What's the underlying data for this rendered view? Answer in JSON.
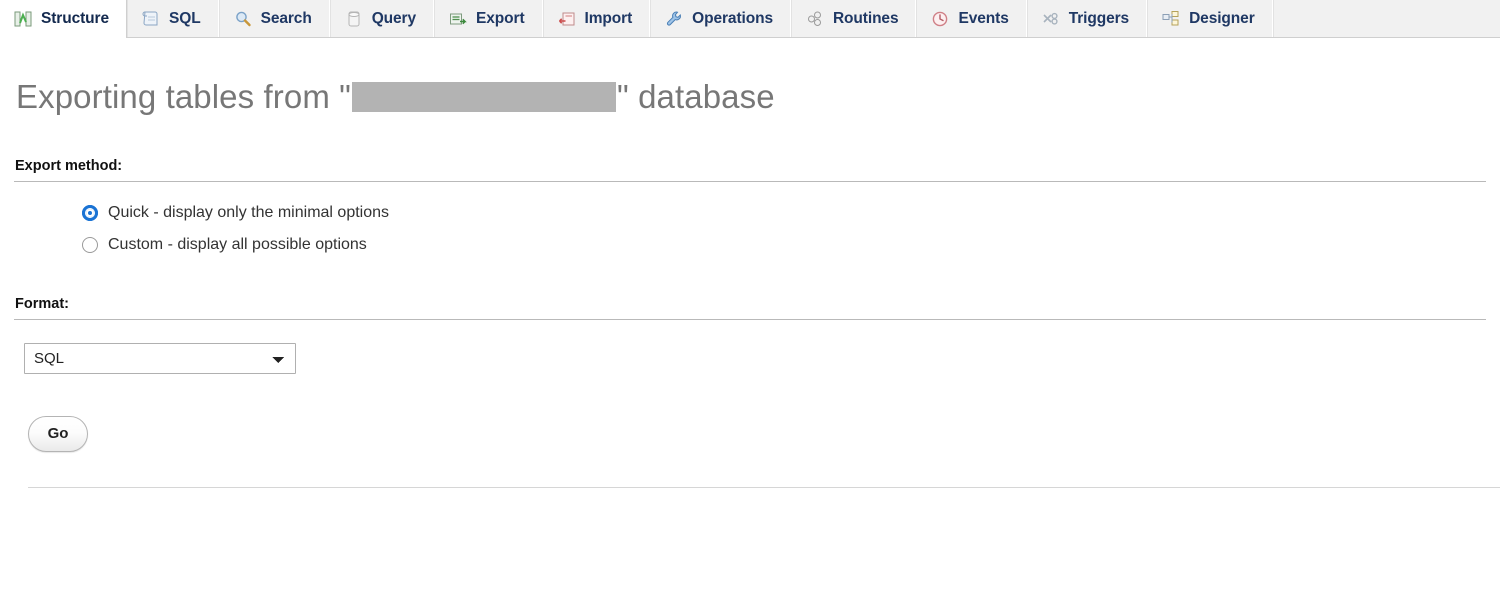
{
  "tabs": [
    {
      "label": "Structure",
      "icon": "structure-icon",
      "active": true
    },
    {
      "label": "SQL",
      "icon": "sql-icon",
      "active": false
    },
    {
      "label": "Search",
      "icon": "search-icon",
      "active": false
    },
    {
      "label": "Query",
      "icon": "query-icon",
      "active": false
    },
    {
      "label": "Export",
      "icon": "export-icon",
      "active": false
    },
    {
      "label": "Import",
      "icon": "import-icon",
      "active": false
    },
    {
      "label": "Operations",
      "icon": "wrench-icon",
      "active": false
    },
    {
      "label": "Routines",
      "icon": "routines-icon",
      "active": false
    },
    {
      "label": "Events",
      "icon": "clock-icon",
      "active": false
    },
    {
      "label": "Triggers",
      "icon": "triggers-icon",
      "active": false
    },
    {
      "label": "Designer",
      "icon": "designer-icon",
      "active": false
    }
  ],
  "page": {
    "title_prefix": "Exporting tables from \"",
    "database_name": "",
    "title_suffix": "\" database"
  },
  "export_method": {
    "heading": "Export method:",
    "options": [
      {
        "label": "Quick - display only the minimal options",
        "selected": true
      },
      {
        "label": "Custom - display all possible options",
        "selected": false
      }
    ]
  },
  "format": {
    "heading": "Format:",
    "selected": "SQL",
    "options": [
      "SQL"
    ]
  },
  "actions": {
    "go_label": "Go"
  },
  "colors": {
    "tab_text": "#1f3864",
    "tab_active_bg": "#ffffff",
    "tab_inactive_bg": "#f1f1f1",
    "title_text": "#777777",
    "radio_accent": "#1a73d4",
    "redaction": "#b3b3b3"
  }
}
